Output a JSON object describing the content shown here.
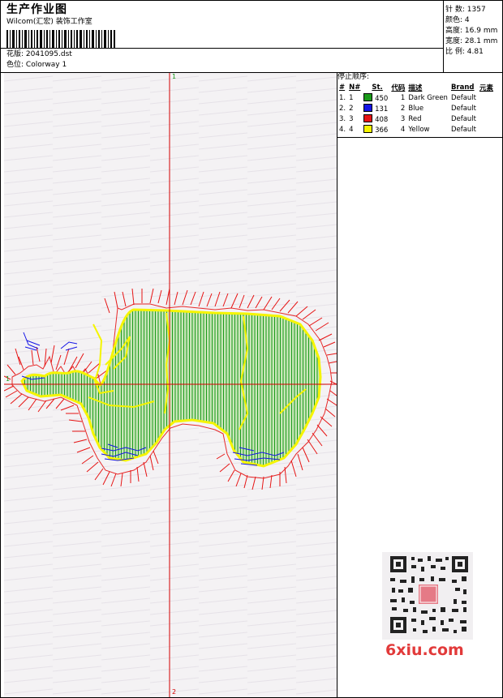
{
  "header": {
    "title": "生产作业图",
    "company": "Wilcom(汇宏) 装饰工作室",
    "design_label": "花版:",
    "design_file": "2041095.dst",
    "colorway_label": "色位:",
    "colorway": "Colorway 1"
  },
  "stats": [
    {
      "label": "针 数:",
      "value": "1357"
    },
    {
      "label": "颜色:",
      "value": "4"
    },
    {
      "label": "高度:",
      "value": "16.9 mm"
    },
    {
      "label": "宽度:",
      "value": "28.1 mm"
    },
    {
      "label": "比 例:",
      "value": "4.81"
    }
  ],
  "stop_sequence": {
    "title": "停止顺序:",
    "headers": [
      "#",
      "N#",
      "St.",
      "代码",
      "描述",
      "Brand",
      "元素"
    ],
    "rows": [
      {
        "num": "1.",
        "n": "1",
        "color": "#1a9a1a",
        "st": "450",
        "code": "1",
        "desc": "Dark Green",
        "brand": "Default"
      },
      {
        "num": "2.",
        "n": "2",
        "color": "#1414e6",
        "st": "131",
        "code": "2",
        "desc": "Blue",
        "brand": "Default"
      },
      {
        "num": "3.",
        "n": "3",
        "color": "#e61414",
        "st": "408",
        "code": "3",
        "desc": "Red",
        "brand": "Default"
      },
      {
        "num": "4.",
        "n": "4",
        "color": "#f5f500",
        "st": "366",
        "code": "4",
        "desc": "Yellow",
        "brand": "Default"
      }
    ]
  },
  "axis": {
    "top_marker": "1",
    "bottom_marker": "2",
    "left_marker": "1"
  },
  "watermark": {
    "logo_text": "6xiu.com",
    "seal_text": "汇宏装饰"
  },
  "colors": {
    "dark_green": "#1a9a1a",
    "blue": "#1414e6",
    "red": "#e61414",
    "yellow": "#f5f500",
    "crosshair": "#d40000"
  }
}
